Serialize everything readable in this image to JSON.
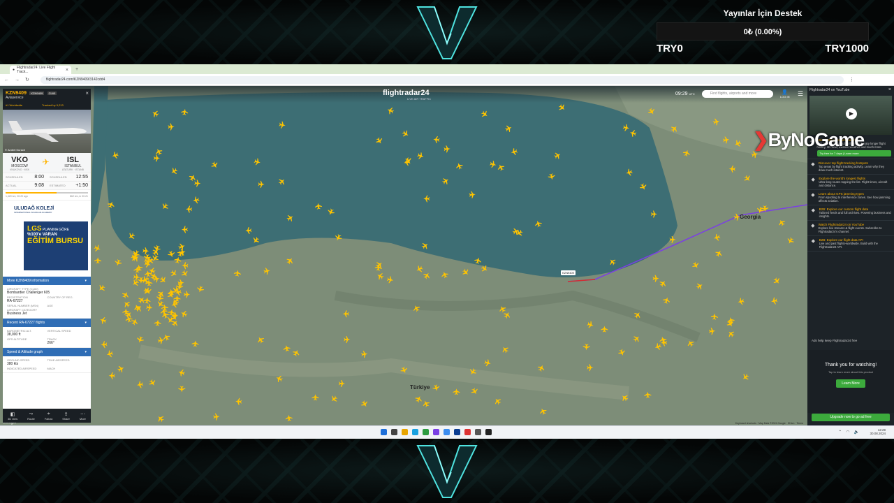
{
  "overlay": {
    "donation_title": "Yayınlar İçin Destek",
    "donation_amount": "0₺ (0.00%)",
    "donation_min": "TRY0",
    "donation_max": "TRY1000",
    "sponsor_logo": "ByNoGame"
  },
  "browser": {
    "tab_title": "Flightradar24: Live Flight Track...",
    "url": "flightradar24.com/KZN9409/3142cdd4"
  },
  "header": {
    "brand": "flightradar24",
    "brand_sub": "LIVE AIR TRAFFIC",
    "time": "09:29",
    "time_zone": "UTC",
    "search_placeholder": "Find flights, airports and more",
    "login": "LOG IN"
  },
  "flight": {
    "callsign": "KZN9409",
    "code1": "KZN9409",
    "code2": "CL60",
    "airline": "Aviaservice",
    "rank": "#1 Worldwide",
    "tracked": "Tracked by 9,213",
    "photo_credit": "© Andrei Kurach",
    "origin_code": "VKO",
    "origin_city": "MOSCOW",
    "origin_sub": "VNUKOVO · MSK",
    "dest_code": "ISL",
    "dest_city": "ISTANBUL",
    "dest_sub": "ATATURK · ISTANB",
    "sched_label": "SCHEDULED",
    "sched_dep": "8:00",
    "sched_arr_label": "SCHEDULED",
    "sched_arr": "12:55",
    "actual_label": "ACTUAL",
    "actual_dep": "9:08",
    "est_label": "ESTIMATED",
    "est_arr": "+1:50",
    "progress_left": "1,420 km, 00:20 ago",
    "progress_right": "862 km, in 00:21",
    "progress": 0.62
  },
  "ad": {
    "school": "ULUDAĞ KOLEJİ",
    "school_sub": "INTERNATIONAL SCHOLAR ACADEMY",
    "line1": "LGS",
    "line1b": "PUANINA GÖRE",
    "line2": "%100'e VARAN",
    "line3": "EĞİTİM BURSU"
  },
  "sections": {
    "more_info": "More KZN9409 information",
    "recent": "Recent RA-67227 flights",
    "speed": "Speed & Altitude graph"
  },
  "details": {
    "aircraft_type_label": "AIRCRAFT TYPE (CL60)",
    "aircraft_type": "Bombardier Challenger 605",
    "registration_label": "REGISTRATION",
    "registration": "RA-67227",
    "country_label": "COUNTRY OF REG.",
    "serial_label": "SERIAL NUMBER (MSN)",
    "age_label": "AGE",
    "category_label": "AIRCRAFT CATEGORY",
    "category": "Business Jet",
    "baro_label": "BAROMETRIC ALT.",
    "baro": "38,000 ft",
    "vs_label": "VERTICAL SPEED",
    "gps_label": "GPS ALTITUDE",
    "track_label": "TRACK",
    "track": "266°",
    "gs_label": "GROUND SPEED",
    "gs": "380 kts",
    "tas_label": "TRUE AIRSPEED",
    "ias_label": "INDICATED AIRSPEED",
    "mach_label": "MACH"
  },
  "footer_buttons": [
    "3D view",
    "Route",
    "Follow",
    "Share",
    "More"
  ],
  "right_panel": {
    "title": "Flightradar24 on YouTube",
    "items": [
      {
        "title": "Unlock 60+ premium features",
        "desc": "Join over 1 million subscribers and enjoy longer flight history, 3D view, aviation weather and much more.",
        "icon": "unlock-icon"
      },
      {
        "title": "Discover top flight tracking hotspots",
        "desc": "Top areas by flight tracking activity. Learn why they draw much interest.",
        "icon": "pin-icon"
      },
      {
        "title": "Explore the world's longest flights",
        "desc": "Ultra-long routes topping the list. Flight times, aircraft and distance.",
        "icon": "plane-icon"
      },
      {
        "title": "Learn about GPS jamming types",
        "desc": "From spoofing to interference zones. See how jamming affects aviation.",
        "icon": "satellite-icon"
      },
      {
        "title": "B2B: Explore our custom flight data",
        "desc": "Tailored feeds and full archives. Powering business and insights.",
        "icon": "data-icon"
      },
      {
        "title": "Watch Flightradar24 on YouTube",
        "desc": "Explore live streams & flight events. Subscribe to Flightradar24's channel.",
        "icon": "youtube-icon"
      },
      {
        "title": "B2B: Explore our flight data API",
        "desc": "Live and past flights-worldwide. Build with the Flightradar24 API.",
        "icon": "api-icon"
      }
    ],
    "trial_button": "Try free for 7 days | Learn more",
    "ads_note": "Ads help keep Flightradar24 free",
    "thanks_title": "Thank you for watching!",
    "thanks_desc": "Tap to learn more about this product",
    "learn_more": "Learn More",
    "upgrade": "Upgrade now to go ad free"
  },
  "map": {
    "countries": [
      "Georgia",
      "Türkiye"
    ],
    "flight_tag": "KZN9409",
    "credits": "Keyboard shortcuts · Map Data ©2024 Google · 50 km · Terms",
    "google": "Google"
  },
  "taskbar": {
    "time": "12:29",
    "date": "30.08.2024"
  },
  "colors": {
    "sea": "#3d6e74",
    "land": "#7d8d78",
    "route": "#7b3fe4",
    "plane": "#ffc400",
    "accent": "#2f6db5",
    "upgrade": "#3caa3c"
  }
}
